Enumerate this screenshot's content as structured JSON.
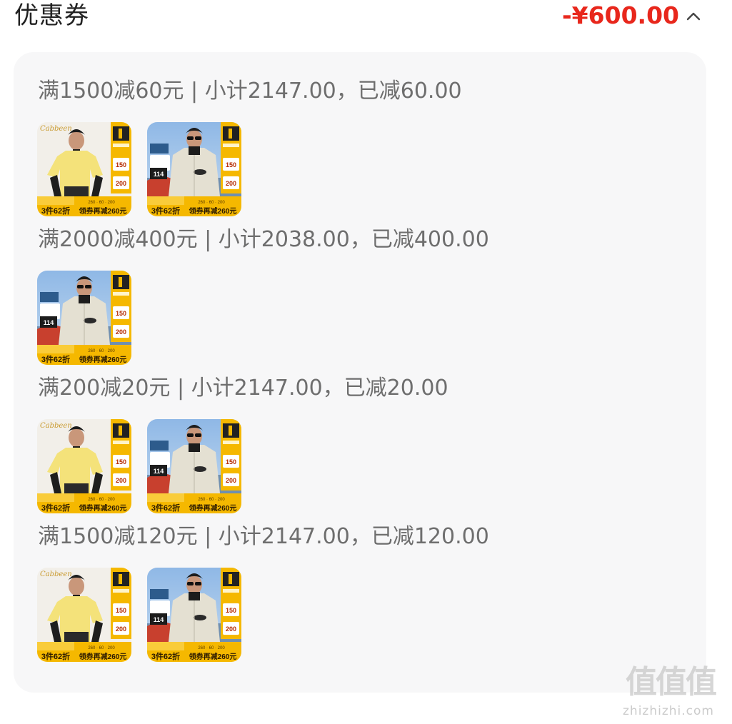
{
  "header": {
    "title": "优惠券",
    "total_discount": "-¥600.00",
    "toggle_icon": "chevron-up-icon"
  },
  "groups": [
    {
      "title": "满1500减60元 | 小计2147.00，已减60.00",
      "products": [
        "yellow-shirt",
        "beige-jacket"
      ]
    },
    {
      "title": "满2000减400元 | 小计2038.00，已减400.00",
      "products": [
        "beige-jacket"
      ]
    },
    {
      "title": "满200减20元 | 小计2147.00，已减20.00",
      "products": [
        "yellow-shirt",
        "beige-jacket"
      ]
    },
    {
      "title": "满1500减120元 | 小计2147.00，已减120.00",
      "products": [
        "yellow-shirt",
        "beige-jacket"
      ]
    }
  ],
  "thumb_text": {
    "brand": "Cabbeen",
    "badge_1": "150",
    "badge_2": "200",
    "promo_left": "3件62折",
    "promo_right": "领券再减260元",
    "tiny_row": "260 · 60 · 200",
    "price_tag": "114"
  },
  "watermark": {
    "logo": "值值值",
    "site": "zhizhizhi.com"
  },
  "colors": {
    "accent": "#e8271c",
    "card_bg": "#f7f7f8",
    "title_text": "#6e6e6e",
    "promo_yellow": "#f5b800"
  }
}
